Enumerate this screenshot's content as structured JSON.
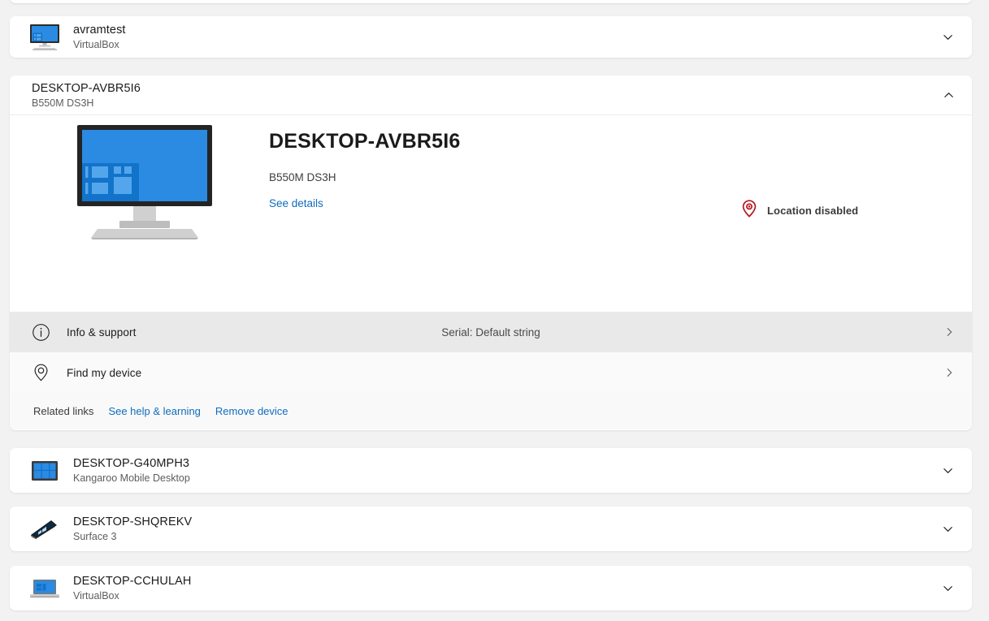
{
  "colors": {
    "page_background": "#f2f2f2",
    "card_background": "#ffffff",
    "accent_link": "#0f6cbd",
    "device_blue": "#2b8ae2",
    "location_red": "#b4171f",
    "row_hover": "#e9e9e9"
  },
  "devices_above": [
    {
      "name": "avramtest",
      "model": "VirtualBox",
      "icon": "desktop-monitor-icon",
      "expand_icon": "chevron-down-icon",
      "expanded": false
    }
  ],
  "expanded_device": {
    "header": {
      "name": "DESKTOP-AVBR5I6",
      "model": "B550M DS3H",
      "collapse_icon": "chevron-up-icon"
    },
    "hero": {
      "image_icon": "desktop-monitor-illustration",
      "title": "DESKTOP-AVBR5I6",
      "model": "B550M DS3H",
      "details_link": "See details",
      "status": {
        "icon": "location-pin-disabled-icon",
        "label": "Location disabled"
      }
    },
    "actions": [
      {
        "icon": "info-circle-icon",
        "label": "Info & support",
        "value": "Serial: Default string",
        "chevron": "chevron-right-icon",
        "hovered": true
      },
      {
        "icon": "location-pin-icon",
        "label": "Find my device",
        "value": "",
        "chevron": "chevron-right-icon",
        "hovered": false
      }
    ],
    "related_links": {
      "label": "Related links",
      "links": [
        "See help & learning",
        "Remove device"
      ]
    }
  },
  "devices_below": [
    {
      "name": "DESKTOP-G40MPH3",
      "model": "Kangaroo Mobile Desktop",
      "icon": "tablet-device-icon",
      "expand_icon": "chevron-down-icon",
      "expanded": false
    },
    {
      "name": "DESKTOP-SHQREKV",
      "model": "Surface 3",
      "icon": "surface-tablet-icon",
      "expand_icon": "chevron-down-icon",
      "expanded": false
    },
    {
      "name": "DESKTOP-CCHULAH",
      "model": "VirtualBox",
      "icon": "laptop-icon",
      "expand_icon": "chevron-down-icon",
      "expanded": false
    }
  ]
}
